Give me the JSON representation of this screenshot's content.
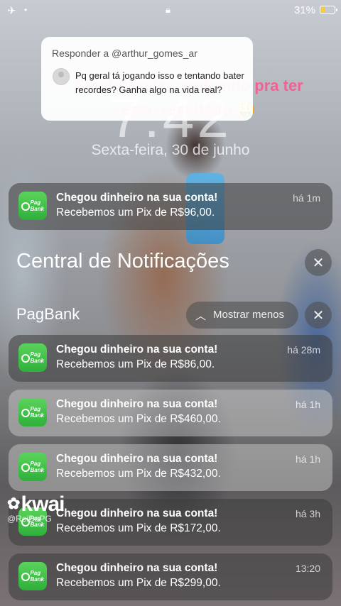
{
  "status": {
    "airplane_icon": "airplane-icon",
    "battery_pct": "31%",
    "battery_level": 0.31,
    "battery_color": "#f4d03f"
  },
  "lockscreen": {
    "time": "7:42",
    "date": "Sexta-feira, 30 de junho"
  },
  "overlay_caption": "Sendo assim ganhando pra ter esse resultado 🤑",
  "reply": {
    "title": "Responder a @arthur_gomes_ar",
    "comment": "Pq geral tá jogando isso e tentando bater recordes? Ganha algo na vida real?"
  },
  "app": {
    "name": "PagBank",
    "icon_text_1": "Pag",
    "icon_text_2": "Bank",
    "accent": "#2eb03a"
  },
  "top_notification": {
    "title": "Chegou dinheiro na sua conta!",
    "body": "Recebemos um Pix de R$96,00.",
    "time": "há 1m"
  },
  "center": {
    "title": "Central de Notificações",
    "group_label": "PagBank",
    "show_less": "Mostrar menos"
  },
  "notifications": [
    {
      "title": "Chegou dinheiro na sua conta!",
      "body": "Recebemos um Pix de R$86,00.",
      "time": "há 28m"
    },
    {
      "title": "Chegou dinheiro na sua conta!",
      "body": "Recebemos um Pix de R$460,00.",
      "time": "há 1h"
    },
    {
      "title": "Chegou dinheiro na sua conta!",
      "body": "Recebemos um Pix de R$432,00.",
      "time": "há 1h"
    },
    {
      "title": "Chegou dinheiro na sua conta!",
      "body": "Recebemos um Pix de R$172,00.",
      "time": "há 3h"
    },
    {
      "title": "Chegou dinheiro na sua conta!",
      "body": "Recebemos um Pix de R$299,00.",
      "time": "13:20"
    }
  ],
  "watermark": {
    "brand": "kwai",
    "handle": "@ReiDaPG"
  }
}
